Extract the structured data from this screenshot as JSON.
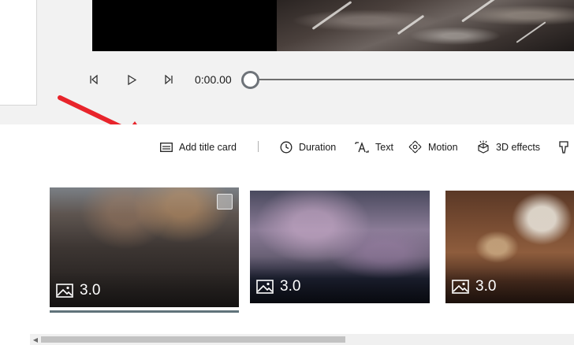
{
  "player": {
    "time": "0:00.00",
    "progress_fraction": 0.0
  },
  "toolbar": {
    "add_title_card": "Add title card",
    "duration": "Duration",
    "text": "Text",
    "motion": "Motion",
    "effects_3d": "3D effects"
  },
  "storyboard": {
    "cards": [
      {
        "duration": "3.0",
        "image": "mountain-peaks",
        "selected": true
      },
      {
        "duration": "3.0",
        "image": "city-bridge-night",
        "selected": false
      },
      {
        "duration": "3.0",
        "image": "restaurant-table",
        "selected": false
      }
    ]
  },
  "colors": {
    "annotation_arrow": "#e8242b",
    "selection_bar": "#60737a",
    "preview_background": "#f2f2f2"
  },
  "icons": [
    "skip-back-icon",
    "play-icon",
    "skip-forward-icon",
    "title-card-icon",
    "clock-icon",
    "text-icon",
    "motion-icon",
    "3d-effects-icon",
    "filter-icon",
    "image-icon"
  ]
}
